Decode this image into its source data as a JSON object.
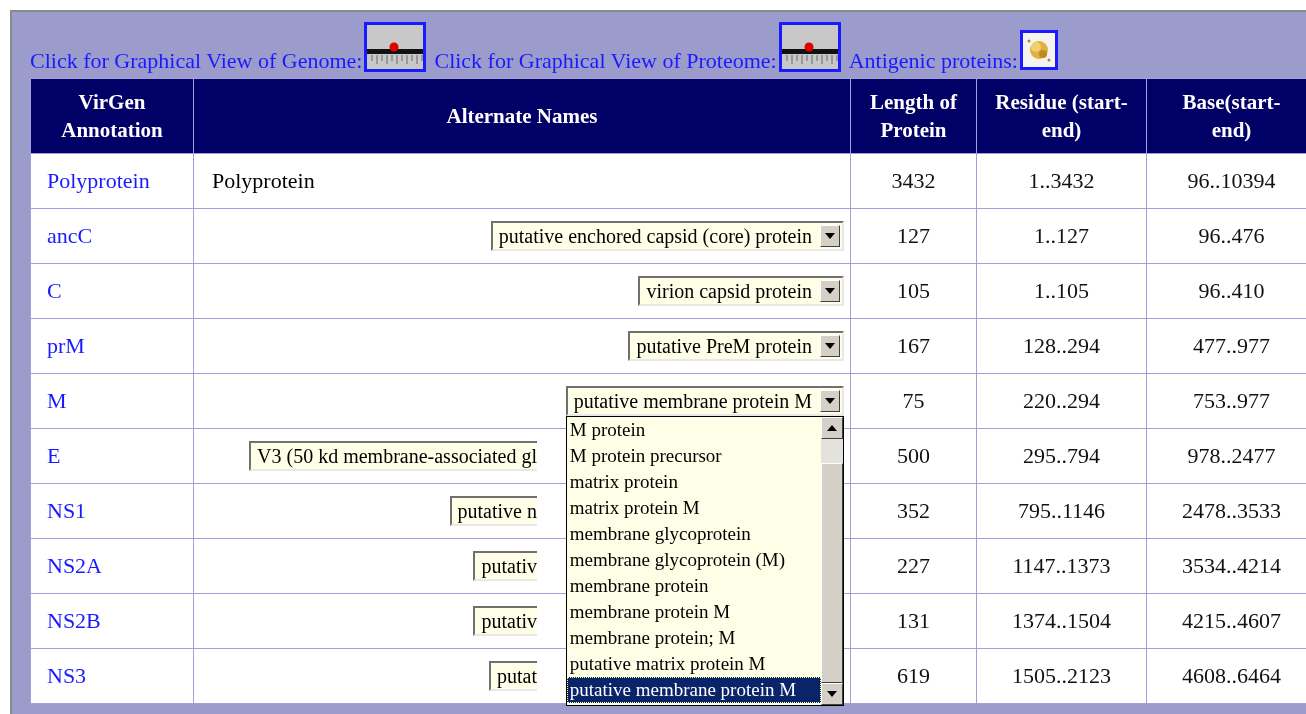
{
  "links": [
    {
      "text": "Click for Graphical View of Genome:",
      "kind": "map"
    },
    {
      "text": "Click for Graphical View of Proteome:",
      "kind": "map"
    },
    {
      "text": "Antigenic proteins:",
      "kind": "blob"
    }
  ],
  "table": {
    "columns": [
      "VirGen Annotation",
      "Alternate Names",
      "Length of Protein",
      "Residue (start-end)",
      "Base(start-\nend)"
    ],
    "rows": [
      {
        "annotation": "Polyprotein",
        "alternate": {
          "kind": "text",
          "value": "Polyprotein"
        },
        "length": "3432",
        "residue": "1..3432",
        "base": "96..10394"
      },
      {
        "annotation": "ancC",
        "alternate": {
          "kind": "select",
          "value": "putative enchored capsid (core) protein"
        },
        "length": "127",
        "residue": "1..127",
        "base": "96..476"
      },
      {
        "annotation": "C",
        "alternate": {
          "kind": "select",
          "value": "virion capsid protein"
        },
        "length": "105",
        "residue": "1..105",
        "base": "96..410"
      },
      {
        "annotation": "prM",
        "alternate": {
          "kind": "select",
          "value": "putative PreM protein"
        },
        "length": "167",
        "residue": "128..294",
        "base": "477..977"
      },
      {
        "annotation": "M",
        "alternate": {
          "kind": "select",
          "value": "putative membrane protein M",
          "expanded": true,
          "options": [
            {
              "text": "M protein",
              "selected": false
            },
            {
              "text": "M protein precursor",
              "selected": false
            },
            {
              "text": "matrix protein",
              "selected": false
            },
            {
              "text": "matrix protein M",
              "selected": false
            },
            {
              "text": "membrane glycoprotein",
              "selected": false
            },
            {
              "text": "membrane glycoprotein (M)",
              "selected": false
            },
            {
              "text": "membrane protein",
              "selected": false
            },
            {
              "text": "membrane protein M",
              "selected": false
            },
            {
              "text": "membrane protein; M",
              "selected": false
            },
            {
              "text": "putative matrix protein M",
              "selected": false
            },
            {
              "text": "putative membrane protein M",
              "selected": true
            }
          ]
        },
        "length": "75",
        "residue": "220..294",
        "base": "753..977"
      },
      {
        "annotation": "E",
        "alternate": {
          "kind": "partial",
          "value": "V3 (50 kd membrane-associated gl"
        },
        "length": "500",
        "residue": "295..794",
        "base": "978..2477"
      },
      {
        "annotation": "NS1",
        "alternate": {
          "kind": "partial",
          "value": "putative n"
        },
        "length": "352",
        "residue": "795..1146",
        "base": "2478..3533"
      },
      {
        "annotation": "NS2A",
        "alternate": {
          "kind": "partial",
          "value": "putativ"
        },
        "length": "227",
        "residue": "1147..1373",
        "base": "3534..4214"
      },
      {
        "annotation": "NS2B",
        "alternate": {
          "kind": "partial",
          "value": "putativ"
        },
        "length": "131",
        "residue": "1374..1504",
        "base": "4215..4607"
      },
      {
        "annotation": "NS3",
        "alternate": {
          "kind": "partial",
          "value": "putat"
        },
        "length": "619",
        "residue": "1505..2123",
        "base": "4608..6464"
      }
    ]
  }
}
